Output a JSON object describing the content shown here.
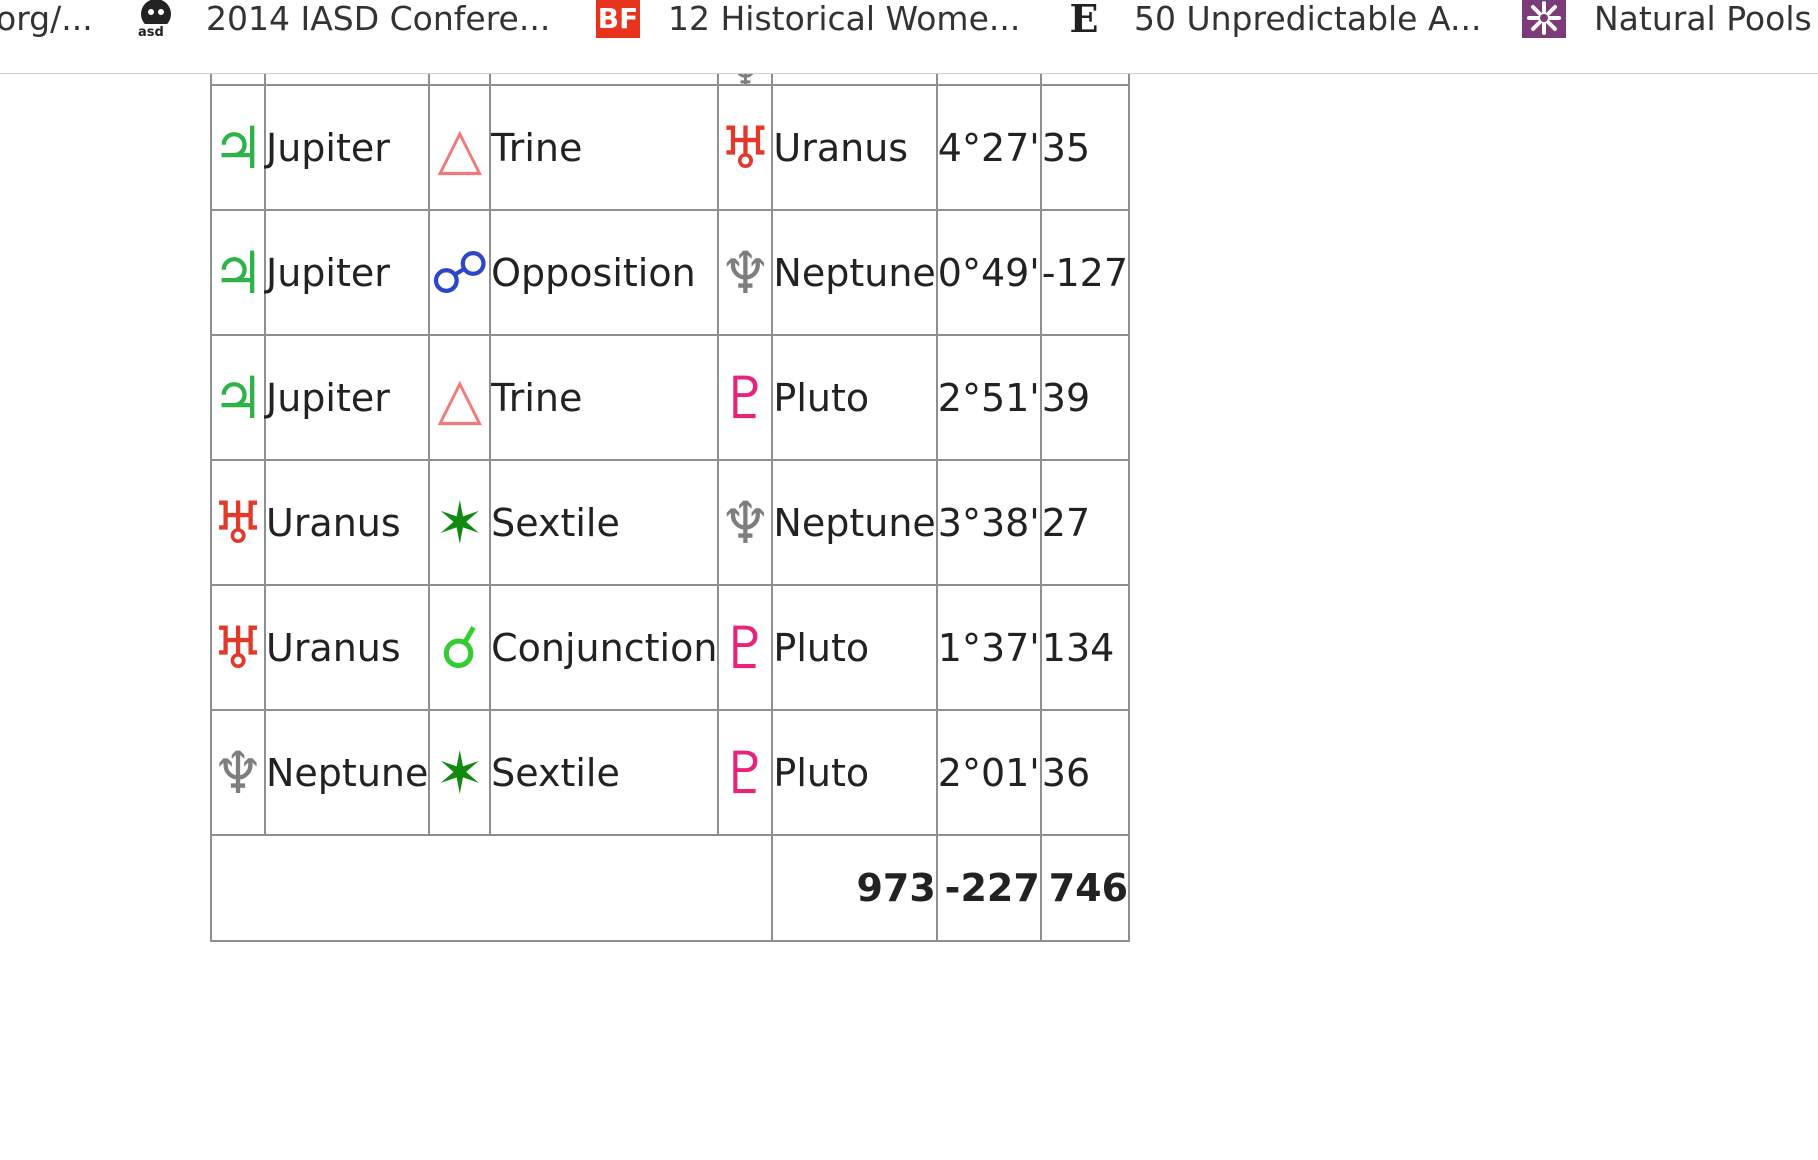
{
  "bookmarks": [
    {
      "label": "org/...",
      "icon": "none"
    },
    {
      "label": "2014 IASD Confere...",
      "icon": "iasd-logo-icon"
    },
    {
      "label": "12 Historical Wome...",
      "icon": "bf-icon",
      "icon_text": "BF"
    },
    {
      "label": "50 Unpredictable A...",
      "icon": "e-icon",
      "icon_text": "E"
    },
    {
      "label": "Natural Pools",
      "icon": "flower-icon"
    }
  ],
  "aspects": {
    "partial_row_glyph": "♆",
    "rows": [
      {
        "p1_glyph": "♃",
        "p1_color": "#2db34a",
        "p1": "Jupiter",
        "asp_glyph": "△",
        "asp_color": "#f07a7a",
        "aspect": "Trine",
        "p2_glyph": "♅",
        "p2_color": "#e23a2a",
        "p2": "Uranus",
        "orb": "4°27'",
        "power": "35"
      },
      {
        "p1_glyph": "♃",
        "p1_color": "#2db34a",
        "p1": "Jupiter",
        "asp_glyph": "☍",
        "asp_color": "#2e46c9",
        "aspect": "Opposition",
        "p2_glyph": "♆",
        "p2_color": "#7e7e7e",
        "p2": "Neptune",
        "orb": "0°49'",
        "power": "-127"
      },
      {
        "p1_glyph": "♃",
        "p1_color": "#2db34a",
        "p1": "Jupiter",
        "asp_glyph": "△",
        "asp_color": "#f07a7a",
        "aspect": "Trine",
        "p2_glyph": "♇",
        "p2_color": "#e8237a",
        "p2": "Pluto",
        "orb": "2°51'",
        "power": "39"
      },
      {
        "p1_glyph": "♅",
        "p1_color": "#e23a2a",
        "p1": "Uranus",
        "asp_glyph": "✶",
        "asp_color": "#128a12",
        "aspect": "Sextile",
        "p2_glyph": "♆",
        "p2_color": "#7e7e7e",
        "p2": "Neptune",
        "orb": "3°38'",
        "power": "27"
      },
      {
        "p1_glyph": "♅",
        "p1_color": "#e23a2a",
        "p1": "Uranus",
        "asp_glyph": "☌",
        "asp_color": "#33cc33",
        "aspect": "Conjunction",
        "p2_glyph": "♇",
        "p2_color": "#e8237a",
        "p2": "Pluto",
        "orb": "1°37'",
        "power": "134"
      },
      {
        "p1_glyph": "♆",
        "p1_color": "#7e7e7e",
        "p1": "Neptune",
        "asp_glyph": "✶",
        "asp_color": "#128a12",
        "aspect": "Sextile",
        "p2_glyph": "♇",
        "p2_color": "#e8237a",
        "p2": "Pluto",
        "orb": "2°01'",
        "power": "36"
      }
    ],
    "totals": {
      "positive": "973",
      "negative": "-227",
      "net": "746"
    }
  }
}
